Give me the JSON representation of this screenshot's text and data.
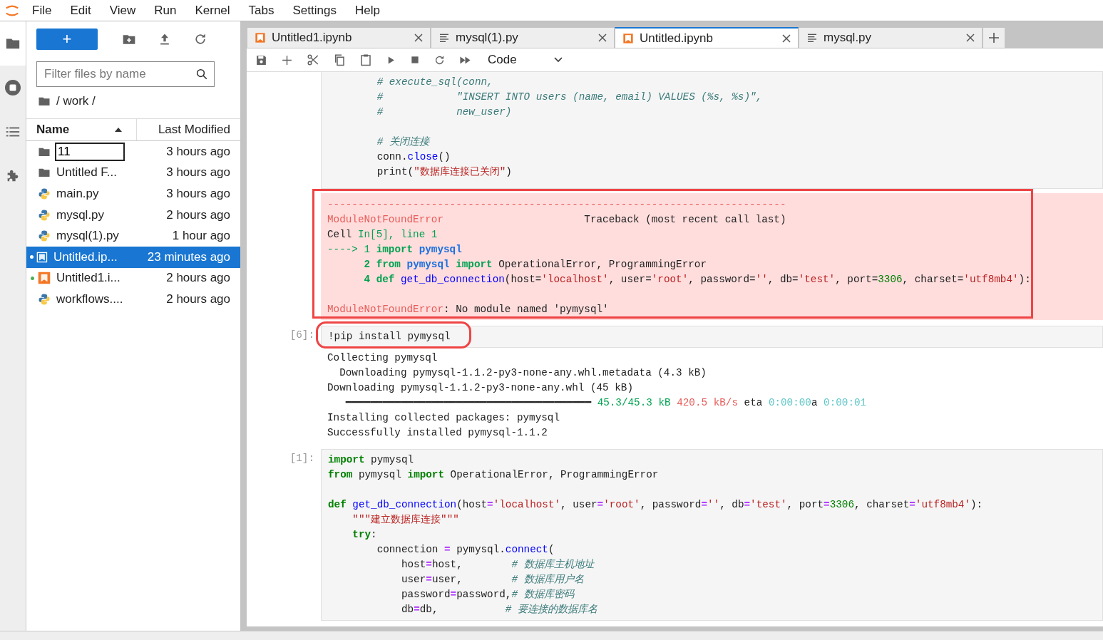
{
  "menu": [
    "File",
    "Edit",
    "View",
    "Run",
    "Kernel",
    "Tabs",
    "Settings",
    "Help"
  ],
  "file_browser": {
    "new_button": "+",
    "filter": {
      "placeholder": "Filter files by name"
    },
    "path": "/ work /",
    "columns": [
      {
        "label": "Name",
        "sorted": true
      },
      {
        "label": "Last Modified",
        "sorted": false
      }
    ],
    "rows": [
      {
        "name": "11",
        "modified": "3 hours ago",
        "kind": "folder",
        "editing": true,
        "selected": false,
        "running": false
      },
      {
        "name": "Untitled F...",
        "modified": "3 hours ago",
        "kind": "folder",
        "editing": false,
        "selected": false,
        "running": false
      },
      {
        "name": "main.py",
        "modified": "3 hours ago",
        "kind": "python",
        "editing": false,
        "selected": false,
        "running": false
      },
      {
        "name": "mysql.py",
        "modified": "2 hours ago",
        "kind": "python",
        "editing": false,
        "selected": false,
        "running": false
      },
      {
        "name": "mysql(1).py",
        "modified": "1 hour ago",
        "kind": "python",
        "editing": false,
        "selected": false,
        "running": false
      },
      {
        "name": "Untitled.ip...",
        "modified": "23 minutes ago",
        "kind": "notebook",
        "editing": false,
        "selected": true,
        "running": true
      },
      {
        "name": "Untitled1.i...",
        "modified": "2 hours ago",
        "kind": "notebook",
        "editing": false,
        "selected": false,
        "running": true
      },
      {
        "name": "workflows....",
        "modified": "2 hours ago",
        "kind": "python",
        "editing": false,
        "selected": false,
        "running": false
      }
    ]
  },
  "tabs": [
    {
      "label": "Untitled1.ipynb",
      "kind": "notebook",
      "selected": false
    },
    {
      "label": "mysql(1).py",
      "kind": "text",
      "selected": false
    },
    {
      "label": "Untitled.ipynb",
      "kind": "notebook",
      "selected": true
    },
    {
      "label": "mysql.py",
      "kind": "text",
      "selected": false
    }
  ],
  "toolbar": {
    "cell_type": "Code"
  },
  "cells": [
    {
      "kind": "code",
      "lines": [
        {
          "tokens": [
            {
              "kind": "comment",
              "text": "        # execute_sql(conn,"
            }
          ]
        },
        {
          "tokens": [
            {
              "kind": "comment",
              "text": "        #            \"INSERT INTO users (name, email) VALUES (%s, %s)\","
            }
          ]
        },
        {
          "tokens": [
            {
              "kind": "comment",
              "text": "        #            new_user)"
            }
          ]
        },
        {
          "blank_before": true,
          "tokens": [
            {
              "kind": "comment",
              "text": "        # 关闭连接"
            }
          ]
        },
        {
          "tokens": [
            {
              "kind": "plain",
              "text": "        conn."
            },
            {
              "kind": "function",
              "text": "close"
            },
            {
              "kind": "plain",
              "text": "()"
            }
          ]
        },
        {
          "tokens": [
            {
              "kind": "plain",
              "text": "        print("
            },
            {
              "kind": "string",
              "text": "\"数据库连接已关闭\""
            },
            {
              "kind": "plain",
              "text": ")"
            }
          ]
        }
      ]
    },
    {
      "kind": "error",
      "highlighted": true,
      "lines": [
        {
          "tokens": [
            {
              "kind": "error",
              "text": "---------------------------------------------------------------------------"
            }
          ]
        },
        {
          "tokens": [
            {
              "kind": "error",
              "text": "ModuleNotFoundError"
            },
            {
              "kind": "plain",
              "text": "                       Traceback (most recent call last)"
            }
          ]
        },
        {
          "tokens": [
            {
              "kind": "plain",
              "text": "Cell "
            },
            {
              "kind": "green",
              "text": "In[5], line 1"
            }
          ]
        },
        {
          "tokens": [
            {
              "kind": "green",
              "text": "----> 1 "
            },
            {
              "kind": "green_bold",
              "text": "import "
            },
            {
              "kind": "blue_bold",
              "text": "pymysql"
            }
          ]
        },
        {
          "tokens": [
            {
              "kind": "green_bold",
              "text": "      2 from "
            },
            {
              "kind": "blue_bold",
              "text": "pymysql"
            },
            {
              "kind": "green_bold",
              "text": " import"
            },
            {
              "kind": "plain",
              "text": " OperationalError, ProgrammingError"
            }
          ]
        },
        {
          "tokens": [
            {
              "kind": "green_bold",
              "text": "      4 def "
            },
            {
              "kind": "function",
              "text": "get_db_connection"
            },
            {
              "kind": "plain",
              "text": "(host="
            },
            {
              "kind": "string",
              "text": "'localhost'"
            },
            {
              "kind": "plain",
              "text": ", user="
            },
            {
              "kind": "string",
              "text": "'root'"
            },
            {
              "kind": "plain",
              "text": ", password="
            },
            {
              "kind": "string",
              "text": "''"
            },
            {
              "kind": "plain",
              "text": ", db="
            },
            {
              "kind": "string",
              "text": "'test'"
            },
            {
              "kind": "plain",
              "text": ", port="
            },
            {
              "kind": "number",
              "text": "3306"
            },
            {
              "kind": "plain",
              "text": ", charset="
            },
            {
              "kind": "string",
              "text": "'utf8mb4'"
            },
            {
              "kind": "plain",
              "text": "):"
            }
          ]
        },
        {
          "blank_before": true,
          "tokens": [
            {
              "kind": "error",
              "text": "ModuleNotFoundError"
            },
            {
              "kind": "plain",
              "text": ": No module named 'pymysql'"
            }
          ]
        }
      ]
    },
    {
      "kind": "code",
      "prompt": "[6]:",
      "highlighted": true,
      "lines": [
        {
          "tokens": [
            {
              "kind": "plain",
              "text": "!pip install pymysql"
            }
          ]
        }
      ]
    },
    {
      "kind": "output",
      "lines": [
        {
          "tokens": [
            {
              "kind": "plain",
              "text": "Collecting pymysql"
            }
          ]
        },
        {
          "tokens": [
            {
              "kind": "plain",
              "text": "  Downloading pymysql-1.1.2-py3-none-any.whl.metadata (4.3 kB)"
            }
          ]
        },
        {
          "tokens": [
            {
              "kind": "plain",
              "text": "Downloading pymysql-1.1.2-py3-none-any.whl (45 kB)"
            }
          ]
        },
        {
          "tokens": [
            {
              "kind": "plain",
              "text": "   ━━━━━━━━━━━━━━━━━━━━━━━━━━━━━━━━━━━━━━━━"
            },
            {
              "kind": "green",
              "text": " 45.3/45.3 kB"
            },
            {
              "kind": "red",
              "text": " 420.5 kB/s"
            },
            {
              "kind": "plain",
              "text": " eta "
            },
            {
              "kind": "cyan",
              "text": "0:00:00"
            },
            {
              "kind": "plain",
              "text": "a "
            },
            {
              "kind": "cyan",
              "text": "0:00:01"
            }
          ]
        },
        {
          "tokens": [
            {
              "kind": "plain",
              "text": "Installing collected packages: pymysql"
            }
          ]
        },
        {
          "tokens": [
            {
              "kind": "plain",
              "text": "Successfully installed pymysql-1.1.2"
            }
          ]
        }
      ]
    },
    {
      "kind": "code",
      "prompt": "[1]:",
      "lines": [
        {
          "tokens": [
            {
              "kind": "keyword",
              "text": "import"
            },
            {
              "kind": "plain",
              "text": " pymysql"
            }
          ]
        },
        {
          "tokens": [
            {
              "kind": "keyword",
              "text": "from"
            },
            {
              "kind": "plain",
              "text": " pymysql "
            },
            {
              "kind": "keyword",
              "text": "import"
            },
            {
              "kind": "plain",
              "text": " OperationalError, ProgrammingError"
            }
          ]
        },
        {
          "blank_before": true,
          "tokens": [
            {
              "kind": "keyword",
              "text": "def"
            },
            {
              "kind": "function",
              "text": " get_db_connection"
            },
            {
              "kind": "plain",
              "text": "(host"
            },
            {
              "kind": "operator",
              "text": "="
            },
            {
              "kind": "string",
              "text": "'localhost'"
            },
            {
              "kind": "plain",
              "text": ", user"
            },
            {
              "kind": "operator",
              "text": "="
            },
            {
              "kind": "string",
              "text": "'root'"
            },
            {
              "kind": "plain",
              "text": ", password"
            },
            {
              "kind": "operator",
              "text": "="
            },
            {
              "kind": "string",
              "text": "''"
            },
            {
              "kind": "plain",
              "text": ", db"
            },
            {
              "kind": "operator",
              "text": "="
            },
            {
              "kind": "string",
              "text": "'test'"
            },
            {
              "kind": "plain",
              "text": ", port"
            },
            {
              "kind": "operator",
              "text": "="
            },
            {
              "kind": "number",
              "text": "3306"
            },
            {
              "kind": "plain",
              "text": ", charset"
            },
            {
              "kind": "operator",
              "text": "="
            },
            {
              "kind": "string",
              "text": "'utf8mb4'"
            },
            {
              "kind": "plain",
              "text": "):"
            }
          ]
        },
        {
          "tokens": [
            {
              "kind": "string",
              "text": "    \"\"\"建立数据库连接\"\"\""
            }
          ]
        },
        {
          "tokens": [
            {
              "kind": "keyword",
              "text": "    try"
            },
            {
              "kind": "plain",
              "text": ":"
            }
          ]
        },
        {
          "tokens": [
            {
              "kind": "plain",
              "text": "        connection "
            },
            {
              "kind": "operator",
              "text": "="
            },
            {
              "kind": "plain",
              "text": " pymysql."
            },
            {
              "kind": "function",
              "text": "connect"
            },
            {
              "kind": "plain",
              "text": "("
            }
          ]
        },
        {
          "tokens": [
            {
              "kind": "plain",
              "text": "            host"
            },
            {
              "kind": "operator",
              "text": "="
            },
            {
              "kind": "plain",
              "text": "host,        "
            },
            {
              "kind": "comment",
              "text": "# 数据库主机地址"
            }
          ]
        },
        {
          "tokens": [
            {
              "kind": "plain",
              "text": "            user"
            },
            {
              "kind": "operator",
              "text": "="
            },
            {
              "kind": "plain",
              "text": "user,        "
            },
            {
              "kind": "comment",
              "text": "# 数据库用户名"
            }
          ]
        },
        {
          "tokens": [
            {
              "kind": "plain",
              "text": "            password"
            },
            {
              "kind": "operator",
              "text": "="
            },
            {
              "kind": "plain",
              "text": "password,"
            },
            {
              "kind": "comment",
              "text": "# 数据库密码"
            }
          ]
        },
        {
          "tokens": [
            {
              "kind": "plain",
              "text": "            db"
            },
            {
              "kind": "operator",
              "text": "="
            },
            {
              "kind": "plain",
              "text": "db,           "
            },
            {
              "kind": "comment",
              "text": "# 要连接的数据库名"
            }
          ]
        }
      ]
    }
  ]
}
